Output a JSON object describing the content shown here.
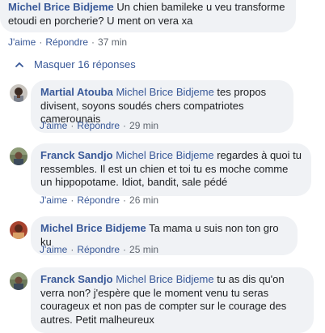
{
  "top_comment": {
    "author": "Michel Brice Bidjeme",
    "text": " Un chien bamileke u veu transforme etoudi en porcherie? U ment on vera xa",
    "like": "J'aime",
    "reply": "Répondre",
    "time": "37 min"
  },
  "replies_toggle": {
    "icon": "chevron-up-icon",
    "label": "Masquer 16 réponses"
  },
  "replies": [
    {
      "author": "Martial Atouba",
      "mention": "Michel Brice Bidjeme",
      "text": " tes propos divisent, soyons soudés chers compatriotes camerounais",
      "like": "J'aime",
      "reply": "Répondre",
      "time": "29 min"
    },
    {
      "author": "Franck Sandjo",
      "mention": "Michel Brice Bidjeme",
      "text": " regardes à quoi tu ressembles. Il est un chien et toi tu es moche comme un hippopotame. Idiot, bandit, sale pédé",
      "like": "J'aime",
      "reply": "Répondre",
      "time": "26 min"
    },
    {
      "author": "Michel Brice Bidjeme",
      "mention": "",
      "text": " Ta mama u suis non ton gro ku",
      "like": "J'aime",
      "reply": "Répondre",
      "time": "25 min"
    },
    {
      "author": "Franck Sandjo",
      "mention": "Michel Brice Bidjeme",
      "text": " tu as dis qu'on verra non? j'espère que le moment venu tu seras courageux et non pas de compter sur le courage des autres. Petit malheureux",
      "like": "",
      "reply": "",
      "time": ""
    }
  ],
  "separator": "·"
}
